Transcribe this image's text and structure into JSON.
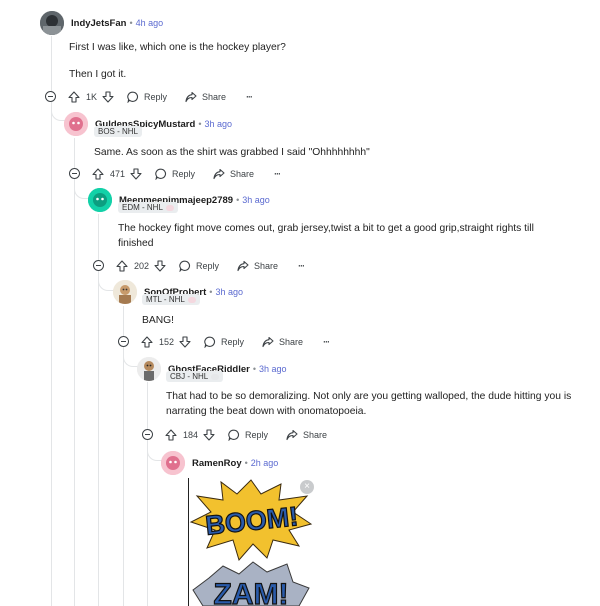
{
  "comments": [
    {
      "username": "IndyJetsFan",
      "time": "4h ago",
      "flair": "",
      "body": [
        "First I was like, which one is the hockey player?",
        "Then I got it."
      ],
      "votes": "1K",
      "reply": "Reply",
      "share": "Share",
      "more": "···"
    },
    {
      "username": "GuldensSpicyMustard",
      "time": "3h ago",
      "flair": "BOS - NHL",
      "body": [
        "Same. As soon as the shirt was grabbed I said \"Ohhhhhhhh\""
      ],
      "votes": "471",
      "reply": "Reply",
      "share": "Share",
      "more": "···"
    },
    {
      "username": "Meepmeepimmajeep2789",
      "time": "3h ago",
      "flair": "EDM - NHL",
      "body": [
        "The hockey fight move comes out, grab jersey,twist a bit to get a good grip,straight rights till finished"
      ],
      "votes": "202",
      "reply": "Reply",
      "share": "Share",
      "more": "···"
    },
    {
      "username": "SonOfProbert",
      "time": "3h ago",
      "flair": "MTL - NHL",
      "body": [
        "BANG!"
      ],
      "votes": "152",
      "reply": "Reply",
      "share": "Share",
      "more": "···"
    },
    {
      "username": "GhostFaceRiddler",
      "time": "3h ago",
      "flair": "CBJ - NHL",
      "body": [
        "That had to be so demoralizing. Not only are you getting walloped, the dude hitting you is narrating the beat down with onomatopoeia."
      ],
      "votes": "184",
      "reply": "Reply",
      "share": "Share",
      "more": "···"
    },
    {
      "username": "RamenRoy",
      "time": "2h ago",
      "flair": "",
      "body": [],
      "image_words": [
        "BOOM!",
        "ZAM!"
      ]
    }
  ],
  "dot": "•",
  "close_glyph": "×",
  "colors": {
    "thread_line": "#e3e5e7",
    "time": "#5b6ad0",
    "flair_bg": "#eaedef",
    "boom_fill": "#2a5bab",
    "boom_burst": "#f2c12e"
  }
}
